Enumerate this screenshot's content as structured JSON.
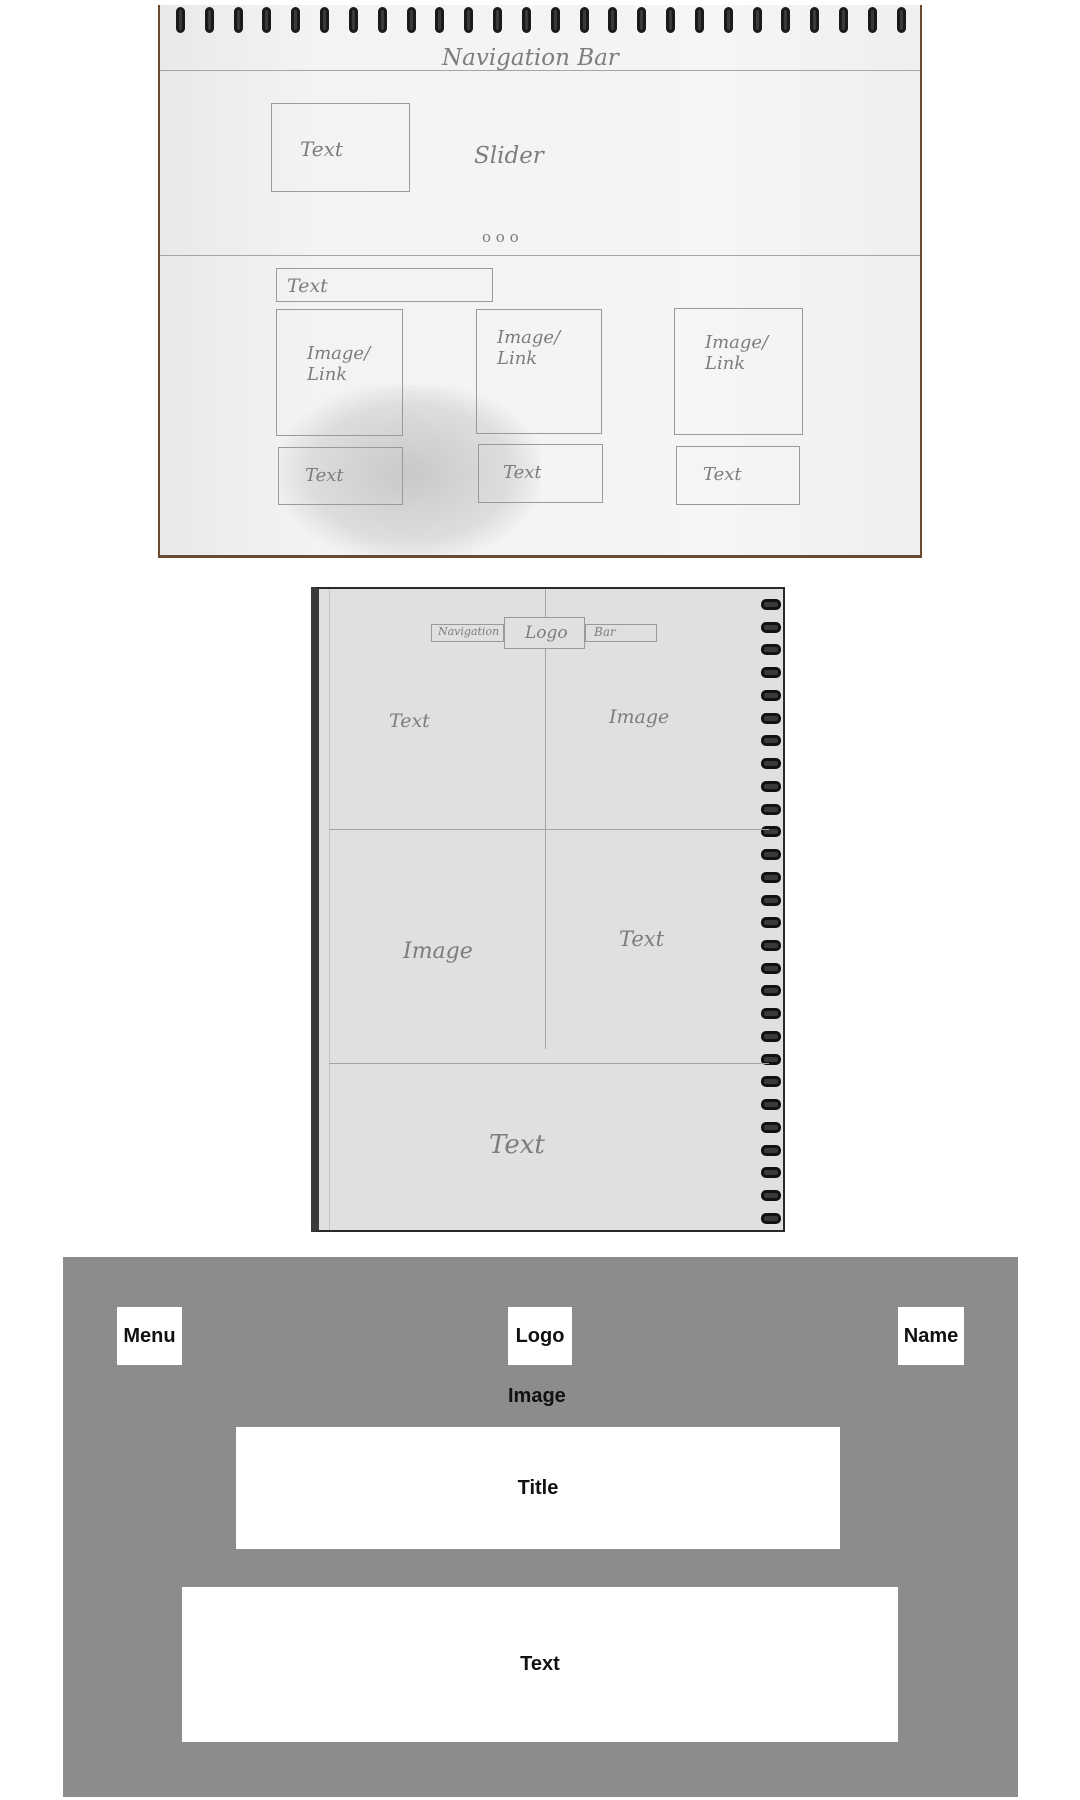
{
  "sketch_landscape": {
    "navigation_bar": "Navigation Bar",
    "slider_text": "Text",
    "slider": "Slider",
    "slider_dots": "o o o",
    "section_text": "Text",
    "cards": [
      {
        "image": "Image/\nLink",
        "text": "Text"
      },
      {
        "image": "Image/\nLink",
        "text": "Text"
      },
      {
        "image": "Image/\nLink",
        "text": "Text"
      }
    ]
  },
  "sketch_portrait": {
    "nav_left": "Navigation",
    "logo": "Logo",
    "nav_right": "Bar",
    "cells": [
      "Text",
      "Image",
      "Image",
      "Text"
    ],
    "footer_text": "Text"
  },
  "wireframe": {
    "menu": "Menu",
    "logo": "Logo",
    "name": "Name",
    "image": "Image",
    "title": "Title",
    "text": "Text",
    "colors": {
      "background": "#8c8c8c",
      "box": "#ffffff"
    }
  }
}
